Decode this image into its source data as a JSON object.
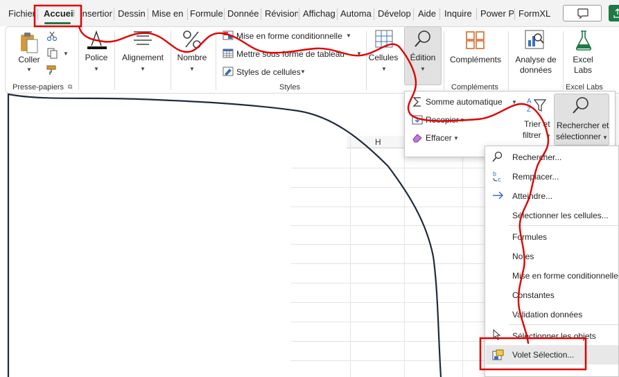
{
  "tabs": [
    "Fichier",
    "Accueil",
    "Insertion",
    "Dessin",
    "Mise en",
    "Formule",
    "Donnée",
    "Révision",
    "Affichag",
    "Automa",
    "Dévelop",
    "Aide",
    "Inquire",
    "Power P",
    "FormXL"
  ],
  "active_tab": "Accueil",
  "ribbon": {
    "clipboard": {
      "paste": "Coller",
      "group": "Presse-papiers"
    },
    "font": "Police",
    "alignment": "Alignement",
    "number": "Nombre",
    "styles": {
      "conditional": "Mise en forme conditionnelle",
      "table": "Mettre sous forme de tableau",
      "cell_styles": "Styles de cellules",
      "group": "Styles"
    },
    "cells": "Cellules",
    "edition": "Édition",
    "addins": {
      "button": "Compléments",
      "group": "Compléments"
    },
    "analyze": {
      "line1": "Analyse de",
      "line2": "données"
    },
    "excel_labs": {
      "line1": "Excel",
      "line2": "Labs",
      "group": "Excel Labs"
    }
  },
  "edition_dropdown": {
    "autosum": "Somme automatique",
    "fill": "Recopier",
    "clear": "Effacer",
    "sort": {
      "line1": "Trier et",
      "line2": "filtrer"
    },
    "find": {
      "line1": "Rechercher et",
      "line2": "sélectionner"
    }
  },
  "column_header": "H",
  "find_menu": {
    "items": [
      "Rechercher...",
      "Remplacer...",
      "Atteindre...",
      "Sélectionner les cellules...",
      "Formules",
      "Notes",
      "Mise en forme conditionnelle",
      "Constantes",
      "Validation données",
      "Sélectionner les objets",
      "Volet Sélection..."
    ]
  },
  "colors": {
    "annotation": "#e00000",
    "accent": "#1d7a44",
    "drawing": "#1f2b3a"
  }
}
